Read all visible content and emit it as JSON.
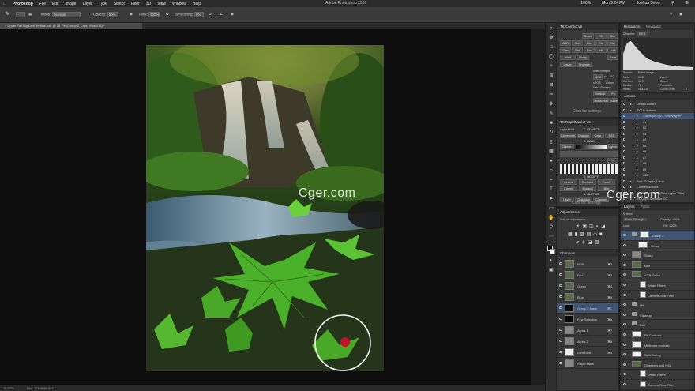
{
  "menubar": {
    "app_name": "Photoshop",
    "items": [
      "File",
      "Edit",
      "Image",
      "Layer",
      "Type",
      "Select",
      "Filter",
      "3D",
      "View",
      "Window",
      "Help"
    ],
    "window_title": "Adobe Photoshop 2020",
    "battery": "100%",
    "clock": "Mon 5:24 PM",
    "user": "Joshua Snow"
  },
  "options_bar": {
    "mode_label": "Mode:",
    "mode_value": "Normal",
    "opacity_label": "Opacity:",
    "opacity_value": "50%",
    "flow_label": "Flow:",
    "flow_value": "100%",
    "smoothing_label": "Smoothing:",
    "smoothing_value": "0%"
  },
  "document_tab": {
    "title": "Upper Fall Big Leaf Vertical.psb @ 16.7% (Group 2, Layer Mask/16) *"
  },
  "status_bar": {
    "zoom": "16.67%",
    "doc_size": "Doc: 176.9M/1.91G"
  },
  "watermarks": {
    "canvas": "Cger.com",
    "panel": "Cger.com"
  },
  "combo_panel": {
    "title": "TK Combo V6",
    "buttons": [
      "Stroke",
      "Fill",
      "Blur",
      "ADR",
      "Soft",
      "Lite",
      "Cut",
      "Sel",
      "Gen",
      "Sat",
      "Luv",
      "Hi",
      "Lum",
      "Vwst",
      "Swap",
      "Save",
      "Layer",
      "Sharpen",
      "Vertical",
      "Fit",
      "Horizontal",
      "Save"
    ],
    "misc": [
      "Web Sharpen",
      "1200",
      "px",
      "AQ",
      "sRGB",
      "Action",
      "Extra Sharpen"
    ],
    "click_for_settings": "Click for settings"
  },
  "rapidmask_panel": {
    "title": "TK RapidMask2 V6",
    "source_header": "1. SOURCE",
    "layer_label": "Layer Mask",
    "source_tabs": [
      "Composite",
      "Channel",
      "Color",
      "SAT"
    ],
    "mask_header": "2. MASK",
    "mask_tabs": [
      "Darker",
      "Lighter"
    ],
    "modify_header": "3. MODIFY",
    "modify_buttons": [
      "Levels",
      "Contrast",
      "Focus",
      "Curves",
      "Expand",
      "Blur"
    ],
    "output_header": "4. OUTPUT",
    "output_tabs": [
      "Layer",
      "Selection",
      "Channel"
    ],
    "click_for_settings": "Click for settings"
  },
  "histogram_panel": {
    "tabs": [
      "Histogram",
      "Navigator"
    ],
    "channel_label": "Channel:",
    "channel_value": "RGB",
    "source_label": "Source:",
    "source_value": "Entire Image",
    "stats_left": [
      [
        "Mean:",
        "86.21"
      ],
      [
        "Std Dev:",
        "64.76"
      ],
      [
        "Median:",
        "72"
      ],
      [
        "Pixels:",
        "4500216"
      ]
    ],
    "stats_right": [
      "Level:",
      "Count:",
      "Percentile:",
      "Cache Level:"
    ],
    "cache_level": "4"
  },
  "actions_panel": {
    "title": "Actions",
    "rows": [
      "Default Actions",
      "TK-V6 Actions",
      "Copyright 2017 Tony Kuyper",
      "#1",
      "#2",
      "#3",
      "#4",
      "#5",
      "#6",
      "#7",
      "#8",
      "#9",
      "#10",
      "Post-Sharpen Action",
      "...Brown Actions",
      "Traditional Orton (Base Lights 2Pin)",
      "TK Quick Selection 5.0"
    ]
  },
  "adjustments_panel": {
    "title": "Adjustments",
    "subtitle": "Add an adjustment"
  },
  "channels_panel": {
    "title": "Channels",
    "rows": [
      {
        "name": "RGB",
        "shortcut": "⌘2"
      },
      {
        "name": "Red",
        "shortcut": "⌘3"
      },
      {
        "name": "Green",
        "shortcut": "⌘4"
      },
      {
        "name": "Blue",
        "shortcut": "⌘5"
      },
      {
        "name": "Group 2 Mask",
        "shortcut": "⌘\\"
      },
      {
        "name": "Fine Selection",
        "shortcut": "⌘6"
      },
      {
        "name": "Alpha 1",
        "shortcut": "⌘7"
      },
      {
        "name": "Alpha 2",
        "shortcut": "⌘8"
      },
      {
        "name": "Lum Lock",
        "shortcut": "⌘9"
      },
      {
        "name": "Rapid Mask",
        "shortcut": ""
      }
    ]
  },
  "layers_panel": {
    "tabs": [
      "Layers",
      "Paths"
    ],
    "kind_label": "Kind",
    "blend_mode": "Pass Through",
    "opacity_label": "Opacity:",
    "opacity_value": "100%",
    "lock_label": "Lock:",
    "fill_label": "Fill:",
    "fill_value": "100%",
    "rows": [
      "Group 2",
      "Group",
      "Sharp",
      "Blur",
      "ACR Finish",
      "Smart Filters",
      "Camera Raw Filter",
      "Hill",
      "Cleanup",
      "Edit",
      "Bit Contrast",
      "Midtones contrast",
      "Split Toning",
      "Gradients and HSL",
      "Smart Filters",
      "Camera Raw Filter"
    ]
  },
  "colors": {
    "menubar_bg": "#2b2b2b",
    "panel_bg": "#383838",
    "selection_blue": "#3f5572",
    "brush_circle": "#ffffff",
    "red_spot": "#c0142a"
  }
}
